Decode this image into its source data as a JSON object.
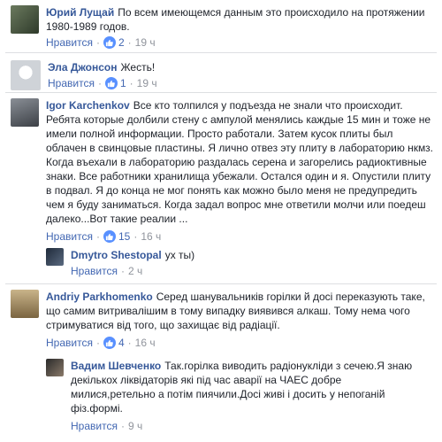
{
  "comments": [
    {
      "author": "Юрий Лущай",
      "text": "По всем имеющемся данным это происходило на протяжении 1980-1989 годов.",
      "like": "Нравится",
      "reactions": "2",
      "time": "19 ч"
    },
    {
      "author": "Эла Джонсон",
      "text": "Жесть!",
      "like": "Нравится",
      "reactions": "1",
      "time": "19 ч"
    },
    {
      "author": "Igor Karchenkov",
      "text": "Все кто толпился у подъезда не знали что происходит. Ребята которые долбили стену с ампулой менялись каждые 15 мин и тоже не имели полной информации. Просто работали. Затем кусок плиты был облачен в свинцовые пластины. Я лично отвез эту плиту в лабораторию нкмз. Когда въехали в лабораторию раздалась серена и загорелись радиоктивные знаки. Все работники хранилища убежали. Остался один и я. Опустили плиту в подвал. Я до конца не мог понять как можно было меня не предупредить чем я буду заниматься. Когда задал вопрос мне ответили молчи или поедеш далеко...Вот такие реалии ...",
      "like": "Нравится",
      "reactions": "15",
      "time": "16 ч",
      "reply": {
        "author": "Dmytro Shestopal",
        "text": "ух ты)",
        "like": "Нравится",
        "time": "2 ч"
      }
    },
    {
      "author": "Andriy Parkhomenko",
      "text": "Серед шанувальників горілки й досі переказують таке, що самим витривалішим в тому випадку виявився алкаш. Тому нема чого стримуватися від того, що захищає від радіації.",
      "like": "Нравится",
      "reactions": "4",
      "time": "16 ч",
      "reply": {
        "author": "Вадим Шевченко",
        "text": "Так.горілка виводить радіонукліди з сечею.Я знаю декількох ліквідаторів які під час аварії на ЧАЕС добре милися,ретельно а потім пиячили.Досі живі і досить у непоганій фіз.формі.",
        "like": "Нравится",
        "time": "9 ч"
      }
    }
  ],
  "colors": {
    "link": "#365899",
    "meta": "#90949c",
    "like_badge": "#5890ff"
  },
  "icons": {
    "reaction": "thumbs-up-icon"
  }
}
